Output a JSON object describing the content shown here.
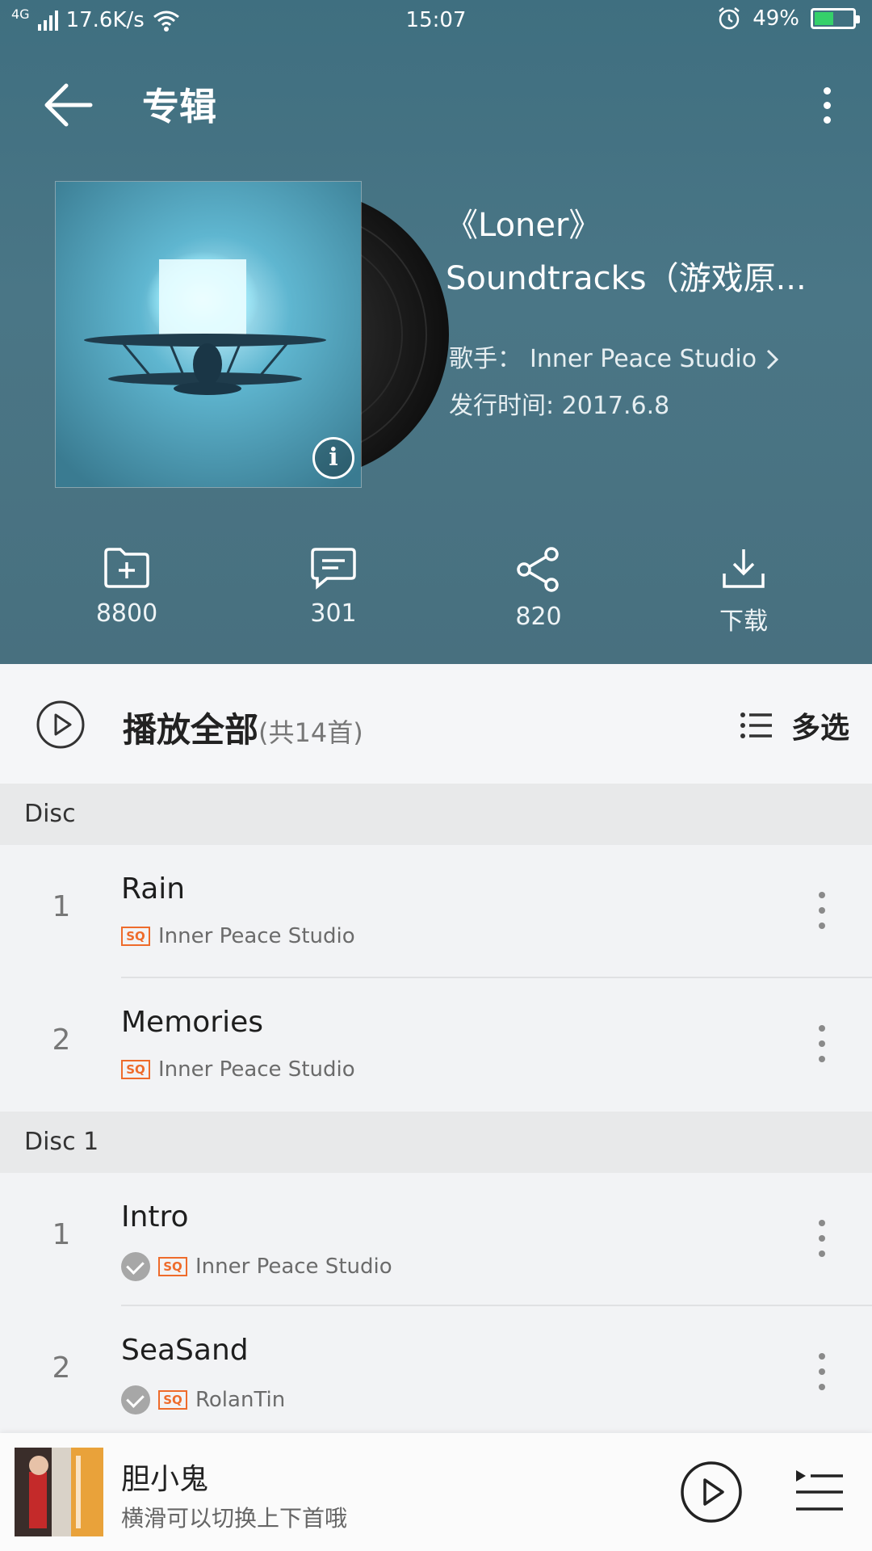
{
  "status_bar": {
    "network": "4G",
    "speed": "17.6K/s",
    "time": "15:07",
    "battery": "49%",
    "icons": [
      "signal-icon",
      "wifi-icon",
      "alarm-icon",
      "battery-icon"
    ]
  },
  "topbar": {
    "title": "专辑"
  },
  "album": {
    "title_line1": "《Loner》",
    "title_line2": "Soundtracks（游戏原...",
    "artist_label": "歌手：",
    "artist": "Inner Peace Studio",
    "release_label": "发行时间:",
    "release_date": "2017.6.8"
  },
  "actions": {
    "collect_count": "8800",
    "comment_count": "301",
    "share_count": "820",
    "download_label": "下载"
  },
  "playall": {
    "label": "播放全部",
    "count": "(共14首)",
    "multi_select": "多选"
  },
  "sections": [
    {
      "header": "Disc",
      "tracks": [
        {
          "index": "1",
          "title": "Rain",
          "quality": "SQ",
          "artist": "Inner Peace Studio",
          "downloaded": false
        },
        {
          "index": "2",
          "title": "Memories",
          "quality": "SQ",
          "artist": "Inner Peace Studio",
          "downloaded": false
        }
      ]
    },
    {
      "header": "Disc 1",
      "tracks": [
        {
          "index": "1",
          "title": "Intro",
          "quality": "SQ",
          "artist": "Inner Peace Studio",
          "downloaded": true
        },
        {
          "index": "2",
          "title": "SeaSand",
          "quality": "SQ",
          "artist": "RolanTin",
          "downloaded": true
        }
      ]
    }
  ],
  "now_playing": {
    "title": "胆小鬼",
    "hint": "横滑可以切换上下首哦"
  },
  "colors": {
    "header_bg": "#48707f",
    "sq_badge": "#ee6b2b",
    "list_bg": "#f2f3f5"
  }
}
